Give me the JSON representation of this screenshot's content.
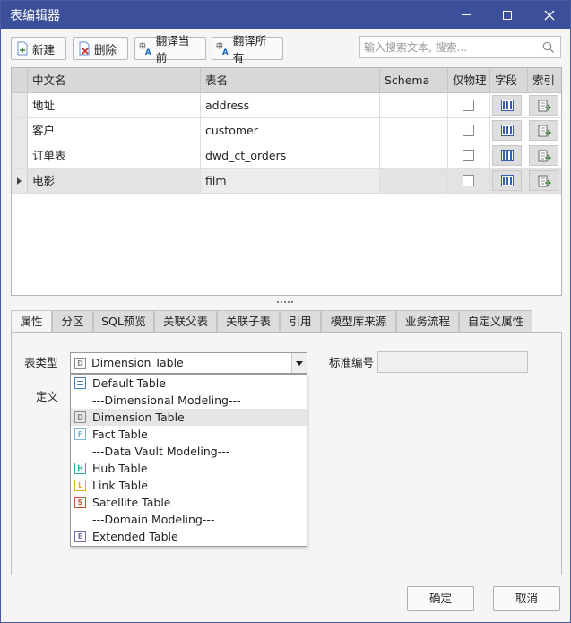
{
  "window": {
    "title": "表编辑器"
  },
  "toolbar": {
    "new_label": "新建",
    "delete_label": "删除",
    "translate_current_label": "翻译当前",
    "translate_all_label": "翻译所有",
    "search_placeholder": "输入搜索文本, 搜索..."
  },
  "grid": {
    "columns": [
      "中文名",
      "表名",
      "Schema",
      "仅物理",
      "字段",
      "索引"
    ],
    "rows": [
      {
        "cn": "地址",
        "name": "address",
        "schema": ""
      },
      {
        "cn": "客户",
        "name": "customer",
        "schema": ""
      },
      {
        "cn": "订单表",
        "name": "dwd_ct_orders",
        "schema": ""
      },
      {
        "cn": "电影",
        "name": "film",
        "schema": ""
      }
    ]
  },
  "tabs": [
    "属性",
    "分区",
    "SQL预览",
    "关联父表",
    "关联子表",
    "引用",
    "模型库来源",
    "业务流程",
    "自定义属性"
  ],
  "properties": {
    "table_type_label": "表类型",
    "table_type_value": "Dimension Table",
    "std_code_label": "标准编号",
    "definition_label": "定义"
  },
  "dropdown": [
    {
      "label": "Default Table",
      "icon": "default-table-icon",
      "letter": "",
      "color": "#4a7fc1"
    },
    {
      "label": "---Dimensional Modeling---",
      "icon": "",
      "letter": "",
      "color": ""
    },
    {
      "label": "Dimension Table",
      "icon": "dimension-table-icon",
      "letter": "D",
      "color": "#8a8a8a"
    },
    {
      "label": "Fact Table",
      "icon": "fact-table-icon",
      "letter": "F",
      "color": "#7ab6d9"
    },
    {
      "label": "---Data Vault Modeling---",
      "icon": "",
      "letter": "",
      "color": ""
    },
    {
      "label": "Hub Table",
      "icon": "hub-table-icon",
      "letter": "H",
      "color": "#2fa6a0"
    },
    {
      "label": "Link Table",
      "icon": "link-table-icon",
      "letter": "L",
      "color": "#d6b21e"
    },
    {
      "label": "Satellite Table",
      "icon": "satellite-table-icon",
      "letter": "S",
      "color": "#c0552e"
    },
    {
      "label": "---Domain Modeling---",
      "icon": "",
      "letter": "",
      "color": ""
    },
    {
      "label": "Extended Table",
      "icon": "extended-table-icon",
      "letter": "E",
      "color": "#7d6aa8"
    }
  ],
  "buttons": {
    "ok": "确定",
    "cancel": "取消"
  },
  "colors": {
    "titlebar": "#3b4f9a"
  }
}
